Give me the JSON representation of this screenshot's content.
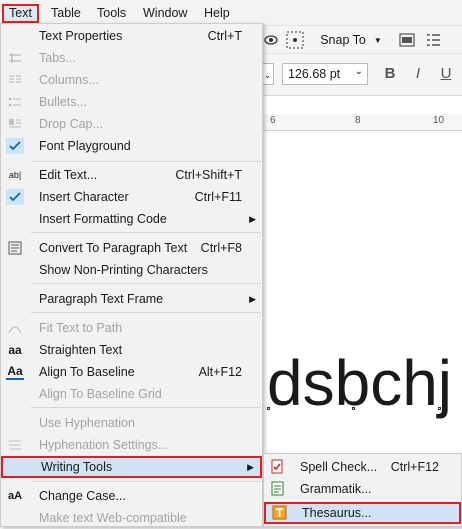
{
  "menubar": {
    "items": [
      "Text",
      "Table",
      "Tools",
      "Window",
      "Help"
    ]
  },
  "toolbar": {
    "snap_label": "Snap To"
  },
  "propbar": {
    "font_size": "126.68 pt"
  },
  "ruler": {
    "tick_6": "6",
    "tick_8": "8",
    "tick_10": "10"
  },
  "canvas": {
    "sample_text": "dsbchj"
  },
  "text_menu": {
    "items": [
      {
        "label": "Text Properties",
        "shortcut": "Ctrl+T"
      },
      {
        "label": "Tabs..."
      },
      {
        "label": "Columns..."
      },
      {
        "label": "Bullets..."
      },
      {
        "label": "Drop Cap..."
      },
      {
        "label": "Font Playground"
      },
      {
        "label": "Edit Text...",
        "shortcut": "Ctrl+Shift+T"
      },
      {
        "label": "Insert Character",
        "shortcut": "Ctrl+F11"
      },
      {
        "label": "Insert Formatting Code"
      },
      {
        "label": "Convert To Paragraph Text",
        "shortcut": "Ctrl+F8"
      },
      {
        "label": "Show Non-Printing Characters"
      },
      {
        "label": "Paragraph Text Frame"
      },
      {
        "label": "Fit Text to Path"
      },
      {
        "label": "Straighten Text"
      },
      {
        "label": "Align To Baseline",
        "shortcut": "Alt+F12"
      },
      {
        "label": "Align To Baseline Grid"
      },
      {
        "label": "Use Hyphenation"
      },
      {
        "label": "Hyphenation Settings..."
      },
      {
        "label": "Writing Tools"
      },
      {
        "label": "Change Case..."
      },
      {
        "label": "Make text Web-compatible"
      }
    ]
  },
  "writing_tools_submenu": {
    "items": [
      {
        "label": "Spell Check...",
        "shortcut": "Ctrl+F12"
      },
      {
        "label": "Grammatik..."
      },
      {
        "label": "Thesaurus..."
      }
    ]
  }
}
